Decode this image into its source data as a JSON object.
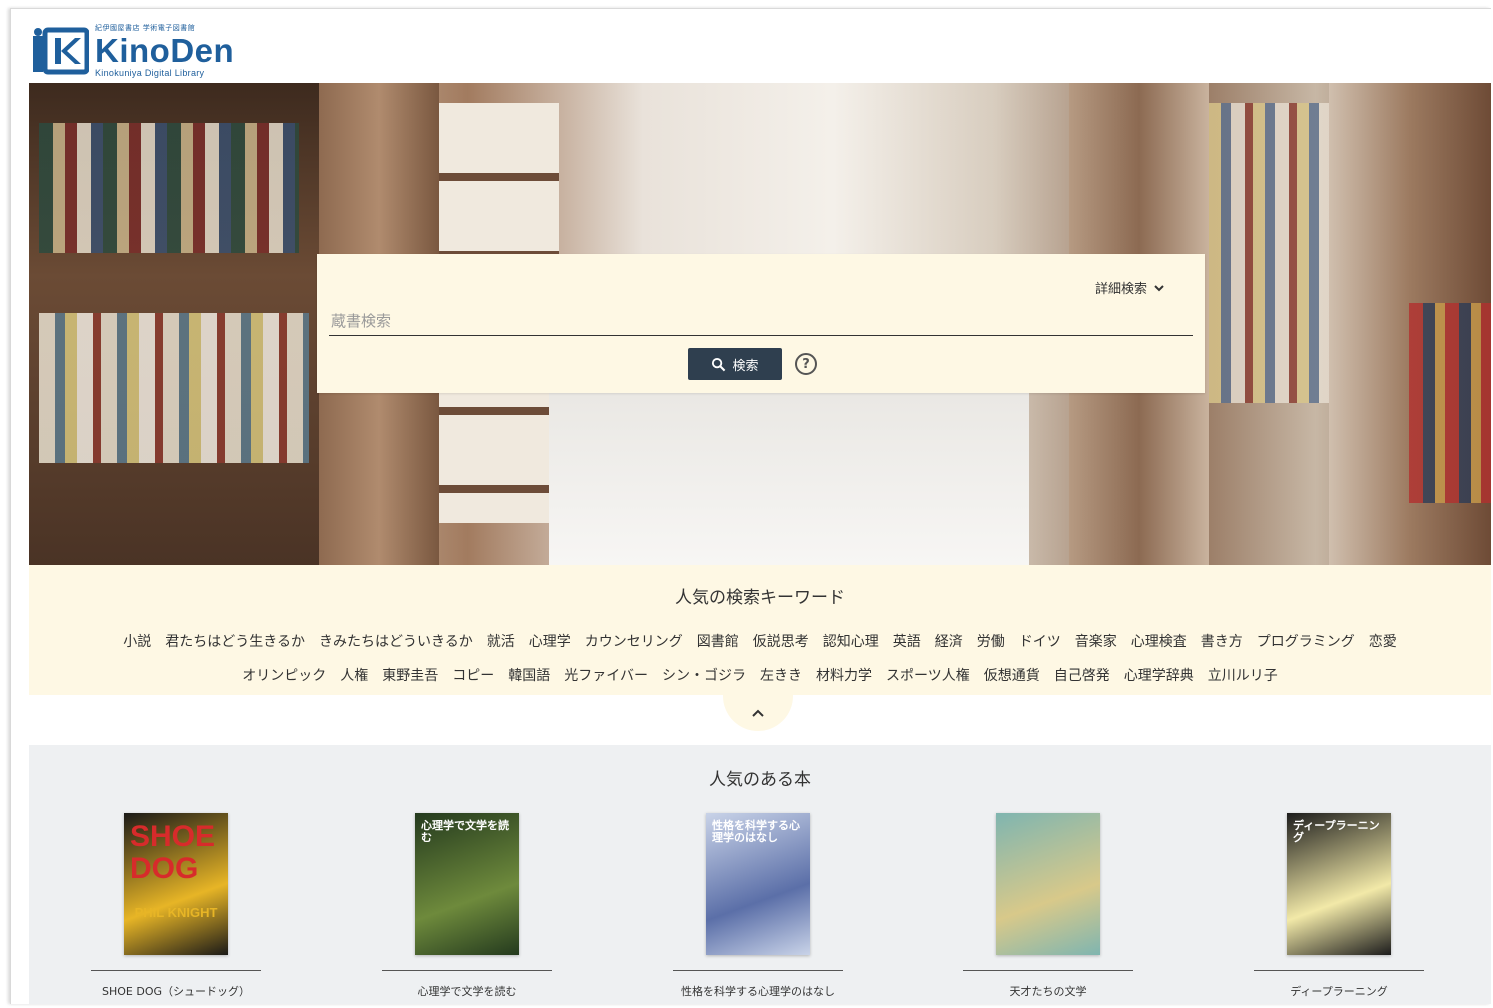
{
  "header": {
    "logo_small": "紀伊國屋書店 学術電子図書館",
    "logo_name": "KinoDen",
    "logo_sub": "Kinokuniya Digital Library"
  },
  "search": {
    "advanced_label": "詳細検索",
    "placeholder": "蔵書検索",
    "button_label": "検索",
    "help_symbol": "?"
  },
  "keywords": {
    "title": "人気の検索キーワード",
    "row1": [
      "小説",
      "君たちはどう生きるか",
      "きみたちはどういきるか",
      "就活",
      "心理学",
      "カウンセリング",
      "図書館",
      "仮説思考",
      "認知心理",
      "英語",
      "経済",
      "労働",
      "ドイツ",
      "音楽家",
      "心理検査",
      "書き方",
      "プログラミング",
      "恋愛"
    ],
    "row2": [
      "オリンピック",
      "人権",
      "東野圭吾",
      "コピー",
      "韓国語",
      "光ファイバー",
      "シン・ゴジラ",
      "左きき",
      "材料力学",
      "スポーツ人権",
      "仮想通貨",
      "自己啓発",
      "心理学辞典",
      "立川ルリ子"
    ]
  },
  "popular": {
    "title": "人気のある本",
    "books": [
      {
        "title": "SHOE DOG（シュードッグ）",
        "cover_text": "SHOE DOG",
        "cover_author": "PHIL KNIGHT",
        "colors": [
          "#1b1a18",
          "#e7b526",
          "#d72b2b"
        ]
      },
      {
        "title": "心理学で文学を読む",
        "cover_text": "心理学で文学を読む",
        "colors": [
          "#243a1e",
          "#6e8a3c",
          "#ffffff"
        ]
      },
      {
        "title": "性格を科学する心理学のはなし",
        "cover_text": "性格を科学する心理学のはなし",
        "colors": [
          "#c9d3e8",
          "#5b6fa8",
          "#ffffff"
        ]
      },
      {
        "title": "天才たちの文学",
        "cover_text": "",
        "colors": [
          "#7fb5b0",
          "#d8c98a",
          "#c0504d"
        ]
      },
      {
        "title": "ディープラーニング",
        "cover_text": "ディープラーニング",
        "colors": [
          "#1c1c1c",
          "#f2e9a8",
          "#ffffff"
        ]
      }
    ]
  }
}
